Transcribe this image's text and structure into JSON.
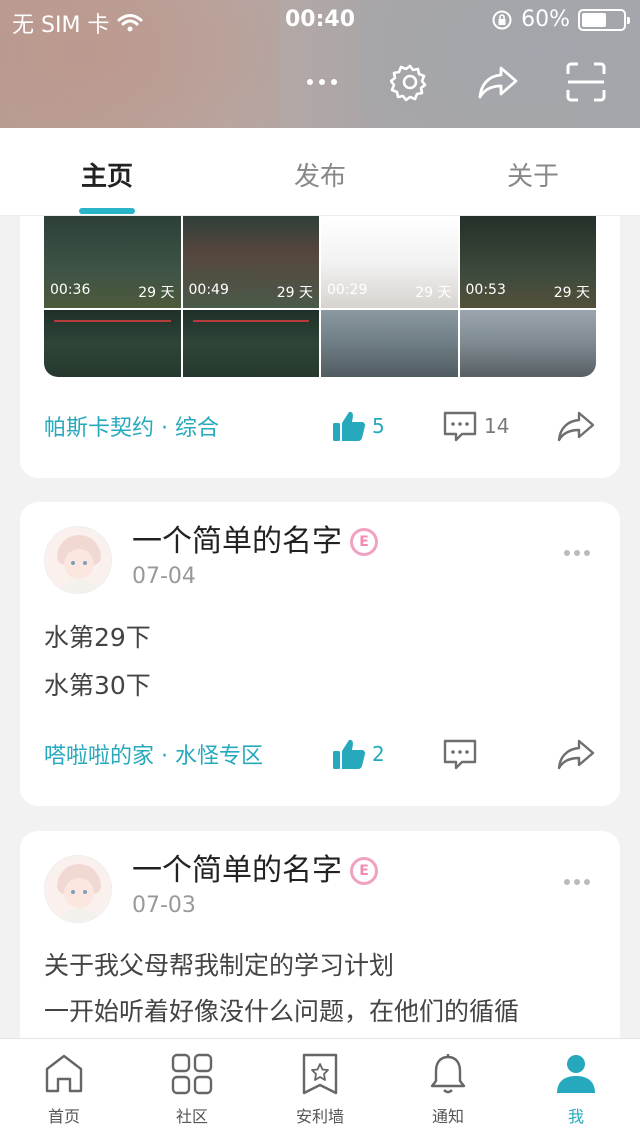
{
  "status_bar": {
    "carrier": "无 SIM 卡",
    "time": "00:40",
    "battery": "60%",
    "battery_level": 0.6
  },
  "tabs": [
    {
      "label": "主页",
      "active": true
    },
    {
      "label": "发布",
      "active": false
    },
    {
      "label": "关于",
      "active": false
    }
  ],
  "post1": {
    "videos": [
      {
        "duration": "00:36",
        "age": "29 天"
      },
      {
        "duration": "00:49",
        "age": "29 天"
      },
      {
        "duration": "00:29",
        "age": "29 天"
      },
      {
        "duration": "00:53",
        "age": "29 天"
      }
    ],
    "tag": "帕斯卡契约 · 综合",
    "likes": "5",
    "comments": "14"
  },
  "post2": {
    "author": "一个简单的名字",
    "date": "07-04",
    "lines": [
      "水第29下",
      "水第30下"
    ],
    "tag": "嗒啦啦的家 · 水怪专区",
    "likes": "2"
  },
  "post3": {
    "author": "一个简单的名字",
    "date": "07-03",
    "lines": [
      "关于我父母帮我制定的学习计划",
      "一开始听着好像没什么问题，在他们的循循"
    ]
  },
  "badge_letter": "E",
  "bottom_nav": [
    {
      "label": "首页",
      "icon": "home-icon",
      "active": false
    },
    {
      "label": "社区",
      "icon": "grid-icon",
      "active": false
    },
    {
      "label": "安利墙",
      "icon": "bookmark-star-icon",
      "active": false
    },
    {
      "label": "通知",
      "icon": "bell-icon",
      "active": false
    },
    {
      "label": "我",
      "icon": "user-icon",
      "active": true
    }
  ],
  "colors": {
    "accent": "#27a9bd",
    "badge": "#f08bb4"
  }
}
